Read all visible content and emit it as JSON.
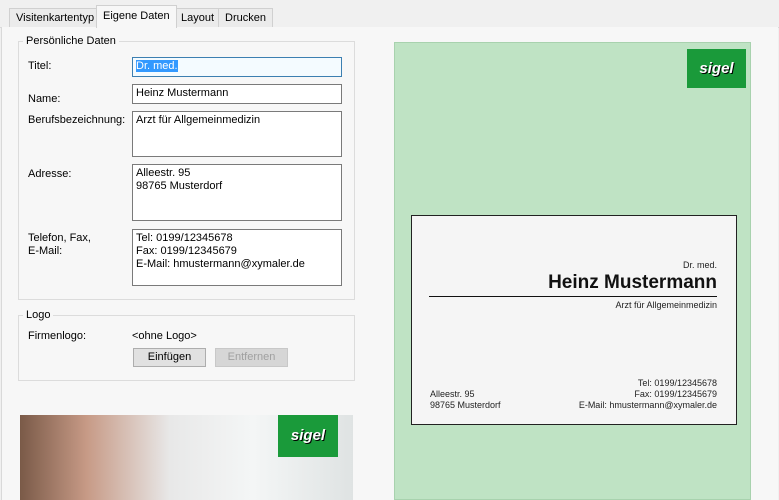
{
  "tabs": [
    "Visitenkartentyp",
    "Eigene Daten",
    "Layout",
    "Drucken"
  ],
  "personal": {
    "legend": "Persönliche Daten",
    "title_label": "Titel:",
    "title_value": "Dr. med.",
    "name_label": "Name:",
    "name_value": "Heinz Mustermann",
    "job_label": "Berufsbezeichnung:",
    "job_value": "Arzt für Allgemeinmedizin",
    "address_label": "Adresse:",
    "address_value": "Alleestr. 95\n98765 Musterdorf",
    "contact_label": "Telefon, Fax,\nE-Mail:",
    "contact_value": "Tel: 0199/12345678\nFax: 0199/12345679\nE-Mail: hmustermann@xymaler.de"
  },
  "logo": {
    "legend": "Logo",
    "label": "Firmenlogo:",
    "value": "<ohne Logo>",
    "insert": "Einfügen",
    "remove": "Entfernen"
  },
  "brand": "sigel",
  "card": {
    "title": "Dr. med.",
    "name": "Heinz Mustermann",
    "job": "Arzt für Allgemeinmedizin",
    "street": "Alleestr. 95",
    "city": "98765 Musterdorf",
    "tel": "Tel: 0199/12345678",
    "fax": "Fax: 0199/12345679",
    "email": "E-Mail: hmustermann@xymaler.de"
  }
}
